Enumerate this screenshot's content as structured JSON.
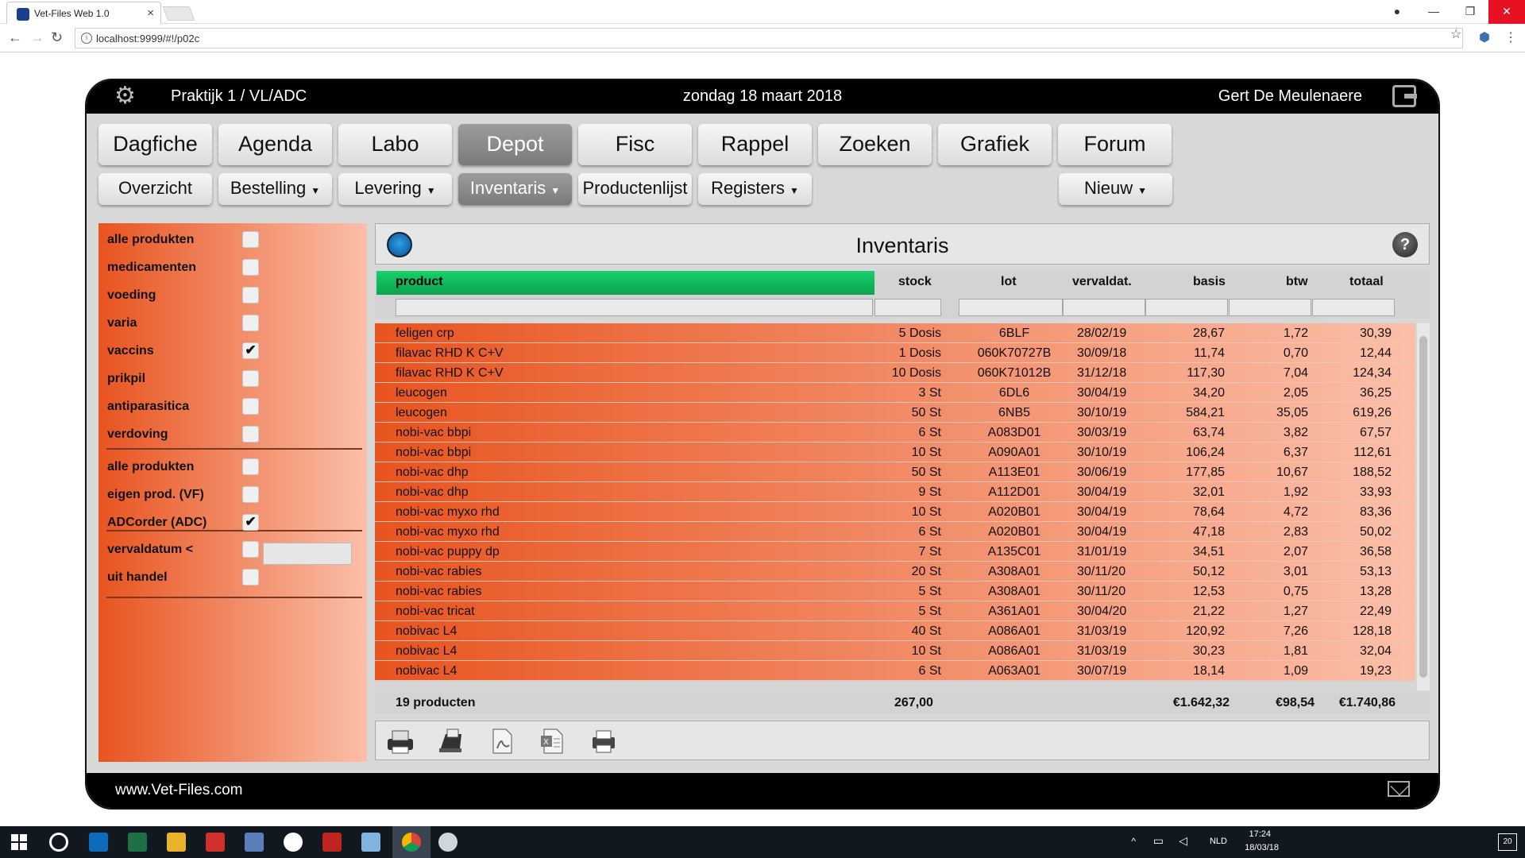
{
  "browser": {
    "tab_title": "Vet-Files Web 1.0",
    "url": "localhost:9999/#!/p02c"
  },
  "header": {
    "practice": "Praktijk 1 / VL/ADC",
    "date": "zondag 18 maart 2018",
    "user": "Gert De Meulenaere"
  },
  "main_nav": [
    "Dagfiche",
    "Agenda",
    "Labo",
    "Depot",
    "Fisc",
    "Rappel",
    "Zoeken",
    "Grafiek",
    "Forum"
  ],
  "main_nav_active": "Depot",
  "sub_nav": {
    "overzicht": "Overzicht",
    "bestelling": "Bestelling",
    "levering": "Levering",
    "inventaris": "Inventaris",
    "productenlijst": "Productenlijst",
    "registers": "Registers",
    "nieuw": "Nieuw"
  },
  "filters": {
    "group1": [
      {
        "label": "alle produkten",
        "checked": false
      },
      {
        "label": "medicamenten",
        "checked": false
      },
      {
        "label": "voeding",
        "checked": false
      },
      {
        "label": "varia",
        "checked": false
      },
      {
        "label": "vaccins",
        "checked": true
      },
      {
        "label": "prikpil",
        "checked": false
      },
      {
        "label": "antiparasitica",
        "checked": false
      },
      {
        "label": "verdoving",
        "checked": false
      }
    ],
    "group2": [
      {
        "label": "alle produkten",
        "checked": false
      },
      {
        "label": "eigen prod. (VF)",
        "checked": false
      },
      {
        "label": "ADCorder (ADC)",
        "checked": true
      }
    ],
    "group3": [
      {
        "label": "vervaldatum <",
        "checked": false
      },
      {
        "label": "uit handel",
        "checked": false
      }
    ]
  },
  "panel_title": "Inventaris",
  "columns": {
    "product": "product",
    "stock": "stock",
    "lot": "lot",
    "vervaldat": "vervaldat.",
    "basis": "basis",
    "btw": "btw",
    "totaal": "totaal"
  },
  "rows": [
    {
      "product": "feligen crp",
      "stock": "5 Dosis",
      "lot": "6BLF",
      "vervaldat": "28/02/19",
      "basis": "28,67",
      "btw": "1,72",
      "totaal": "30,39"
    },
    {
      "product": "filavac RHD K C+V",
      "stock": "1 Dosis",
      "lot": "060K70727B",
      "vervaldat": "30/09/18",
      "basis": "11,74",
      "btw": "0,70",
      "totaal": "12,44"
    },
    {
      "product": "filavac RHD K C+V",
      "stock": "10 Dosis",
      "lot": "060K71012B",
      "vervaldat": "31/12/18",
      "basis": "117,30",
      "btw": "7,04",
      "totaal": "124,34"
    },
    {
      "product": "leucogen",
      "stock": "3 St",
      "lot": "6DL6",
      "vervaldat": "30/04/19",
      "basis": "34,20",
      "btw": "2,05",
      "totaal": "36,25"
    },
    {
      "product": "leucogen",
      "stock": "50 St",
      "lot": "6NB5",
      "vervaldat": "30/10/19",
      "basis": "584,21",
      "btw": "35,05",
      "totaal": "619,26"
    },
    {
      "product": "nobi-vac bbpi",
      "stock": "6 St",
      "lot": "A083D01",
      "vervaldat": "30/03/19",
      "basis": "63,74",
      "btw": "3,82",
      "totaal": "67,57"
    },
    {
      "product": "nobi-vac bbpi",
      "stock": "10 St",
      "lot": "A090A01",
      "vervaldat": "30/10/19",
      "basis": "106,24",
      "btw": "6,37",
      "totaal": "112,61"
    },
    {
      "product": "nobi-vac dhp",
      "stock": "50 St",
      "lot": "A113E01",
      "vervaldat": "30/06/19",
      "basis": "177,85",
      "btw": "10,67",
      "totaal": "188,52"
    },
    {
      "product": "nobi-vac dhp",
      "stock": "9 St",
      "lot": "A112D01",
      "vervaldat": "30/04/19",
      "basis": "32,01",
      "btw": "1,92",
      "totaal": "33,93"
    },
    {
      "product": "nobi-vac myxo rhd",
      "stock": "10 St",
      "lot": "A020B01",
      "vervaldat": "30/04/19",
      "basis": "78,64",
      "btw": "4,72",
      "totaal": "83,36"
    },
    {
      "product": "nobi-vac myxo rhd",
      "stock": "6 St",
      "lot": "A020B01",
      "vervaldat": "30/04/19",
      "basis": "47,18",
      "btw": "2,83",
      "totaal": "50,02"
    },
    {
      "product": "nobi-vac puppy dp",
      "stock": "7 St",
      "lot": "A135C01",
      "vervaldat": "31/01/19",
      "basis": "34,51",
      "btw": "2,07",
      "totaal": "36,58"
    },
    {
      "product": "nobi-vac rabies",
      "stock": "20 St",
      "lot": "A308A01",
      "vervaldat": "30/11/20",
      "basis": "50,12",
      "btw": "3,01",
      "totaal": "53,13"
    },
    {
      "product": "nobi-vac rabies",
      "stock": "5 St",
      "lot": "A308A01",
      "vervaldat": "30/11/20",
      "basis": "12,53",
      "btw": "0,75",
      "totaal": "13,28"
    },
    {
      "product": "nobi-vac tricat",
      "stock": "5 St",
      "lot": "A361A01",
      "vervaldat": "30/04/20",
      "basis": "21,22",
      "btw": "1,27",
      "totaal": "22,49"
    },
    {
      "product": "nobivac L4",
      "stock": "40 St",
      "lot": "A086A01",
      "vervaldat": "31/03/19",
      "basis": "120,92",
      "btw": "7,26",
      "totaal": "128,18"
    },
    {
      "product": "nobivac L4",
      "stock": "10 St",
      "lot": "A086A01",
      "vervaldat": "31/03/19",
      "basis": "30,23",
      "btw": "1,81",
      "totaal": "32,04"
    },
    {
      "product": "nobivac L4",
      "stock": "6 St",
      "lot": "A063A01",
      "vervaldat": "30/07/19",
      "basis": "18,14",
      "btw": "1,09",
      "totaal": "19,23"
    }
  ],
  "totals": {
    "count": "19 producten",
    "stock": "267,00",
    "basis": "€1.642,32",
    "btw": "€98,54",
    "totaal": "€1.740,86"
  },
  "toolbar_icons": [
    "printer-icon",
    "receipt-printer-icon",
    "pdf-icon",
    "excel-icon",
    "label-printer-icon"
  ],
  "footer": {
    "site": "www.Vet-Files.com"
  },
  "taskbar": {
    "lang": "NLD",
    "time": "17:24",
    "date": "18/03/18",
    "notifications": "20"
  }
}
